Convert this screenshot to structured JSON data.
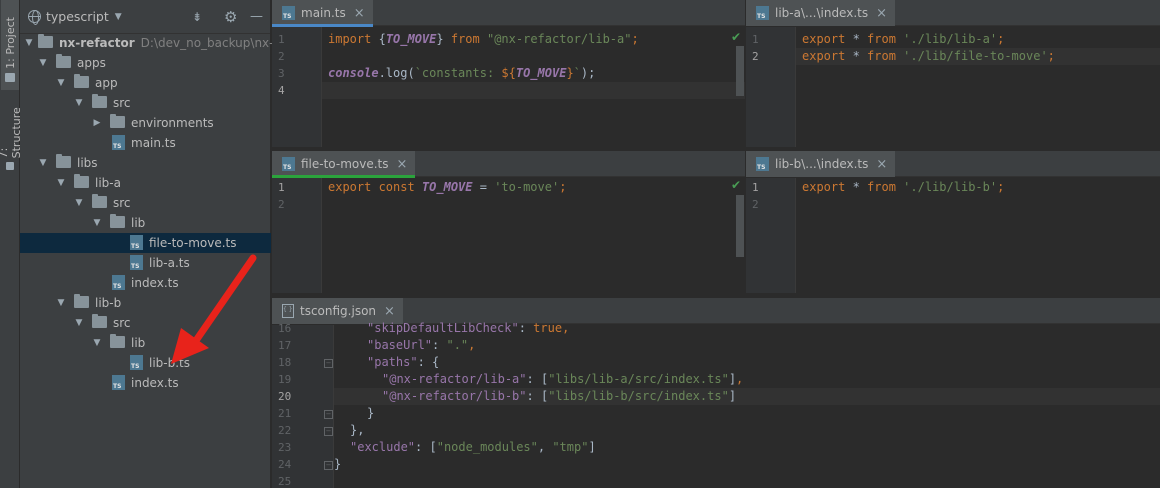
{
  "sidebar_tabs": [
    {
      "label": "1: Project"
    },
    {
      "label": "7: Structure"
    }
  ],
  "project_panel": {
    "scope": "typescript",
    "tree": [
      {
        "label": "nx-refactor",
        "path": "D:\\dev_no_backup\\nx-refa",
        "type": "folder",
        "expanded": true
      },
      {
        "label": "apps",
        "type": "folder",
        "expanded": true
      },
      {
        "label": "app",
        "type": "folder",
        "expanded": true
      },
      {
        "label": "src",
        "type": "folder",
        "expanded": true
      },
      {
        "label": "environments",
        "type": "folder",
        "expanded": false
      },
      {
        "label": "main.ts",
        "type": "ts"
      },
      {
        "label": "libs",
        "type": "folder",
        "expanded": true
      },
      {
        "label": "lib-a",
        "type": "folder",
        "expanded": true
      },
      {
        "label": "src",
        "type": "folder",
        "expanded": true
      },
      {
        "label": "lib",
        "type": "folder",
        "expanded": true
      },
      {
        "label": "file-to-move.ts",
        "type": "ts",
        "selected": true
      },
      {
        "label": "lib-a.ts",
        "type": "ts"
      },
      {
        "label": "index.ts",
        "type": "ts"
      },
      {
        "label": "lib-b",
        "type": "folder",
        "expanded": true
      },
      {
        "label": "src",
        "type": "folder",
        "expanded": true
      },
      {
        "label": "lib",
        "type": "folder",
        "expanded": true
      },
      {
        "label": "lib-b.ts",
        "type": "ts"
      },
      {
        "label": "index.ts",
        "type": "ts"
      }
    ]
  },
  "editors": {
    "main": {
      "tab": "main.ts",
      "line_numbers": [
        "1",
        "2",
        "3",
        "4"
      ],
      "code": {
        "l1_import": "import",
        "l1_open": " {",
        "l1_name": "TO_MOVE",
        "l1_close": "} ",
        "l1_from": "from",
        "l1_src": " \"@nx-refactor/lib-a\"",
        "l1_semi": ";",
        "l3_console": "console",
        "l3_log": ".log(",
        "l3_tpl_a": "`constants: ",
        "l3_tpl_open": "${",
        "l3_tpl_name": "TO_MOVE",
        "l3_tpl_close": "}",
        "l3_tpl_b": "`",
        "l3_end": ");"
      }
    },
    "lib_a_index": {
      "tab": "lib-a\\...\\index.ts",
      "line_numbers": [
        "1",
        "2"
      ],
      "code": {
        "l1_export": "export",
        "l1_star": " * ",
        "l1_from": "from",
        "l1_src": " './lib/lib-a'",
        "l1_semi": ";",
        "l2_export": "export",
        "l2_star": " * ",
        "l2_from": "from",
        "l2_src": " './lib/file-to-move'",
        "l2_semi": ";"
      }
    },
    "file_to_move": {
      "tab": "file-to-move.ts",
      "line_numbers": [
        "1",
        "2"
      ],
      "code": {
        "l1_export": "export const ",
        "l1_name": "TO_MOVE",
        "l1_eq": " = ",
        "l1_val": "'to-move'",
        "l1_semi": ";"
      }
    },
    "lib_b_index": {
      "tab": "lib-b\\...\\index.ts",
      "line_numbers": [
        "1",
        "2"
      ],
      "code": {
        "l1_export": "export",
        "l1_star": " * ",
        "l1_from": "from",
        "l1_src": " './lib/lib-b'",
        "l1_semi": ";"
      }
    },
    "tsconfig": {
      "tab": "tsconfig.json",
      "line_numbers": [
        "16",
        "17",
        "18",
        "19",
        "20",
        "21",
        "22",
        "23",
        "24",
        "25"
      ],
      "code": {
        "l16_key": "\"skipDefaultLibCheck\"",
        "l16_rest": ": ",
        "l16_val": "true",
        "l16_comma": ",",
        "l17_key": "\"baseUrl\"",
        "l17_rest": ": ",
        "l17_val": "\".\"",
        "l17_comma": ",",
        "l18_key": "\"paths\"",
        "l18_rest": ": {",
        "l19_key": "\"@nx-refactor/lib-a\"",
        "l19_rest": ": [",
        "l19_val": "\"libs/lib-a/src/index.ts\"",
        "l19_end": "]",
        "l19_comma": ",",
        "l20_key": "\"@nx-refactor/lib-b\"",
        "l20_rest": ": [",
        "l20_val": "\"libs/lib-b/src/index.ts\"",
        "l20_end": "]",
        "l21": "}",
        "l22": "},",
        "l23_key": "\"exclude\"",
        "l23_rest": ": [",
        "l23_v1": "\"node_modules\"",
        "l23_sep": ", ",
        "l23_v2": "\"tmp\"",
        "l23_end": "]",
        "l24": "}"
      }
    }
  },
  "colors": {
    "keyword": "#cc7832",
    "string": "#6a8759",
    "constant": "#9876aa",
    "plain": "#a9b7c6",
    "arrow": "#e8231b"
  }
}
